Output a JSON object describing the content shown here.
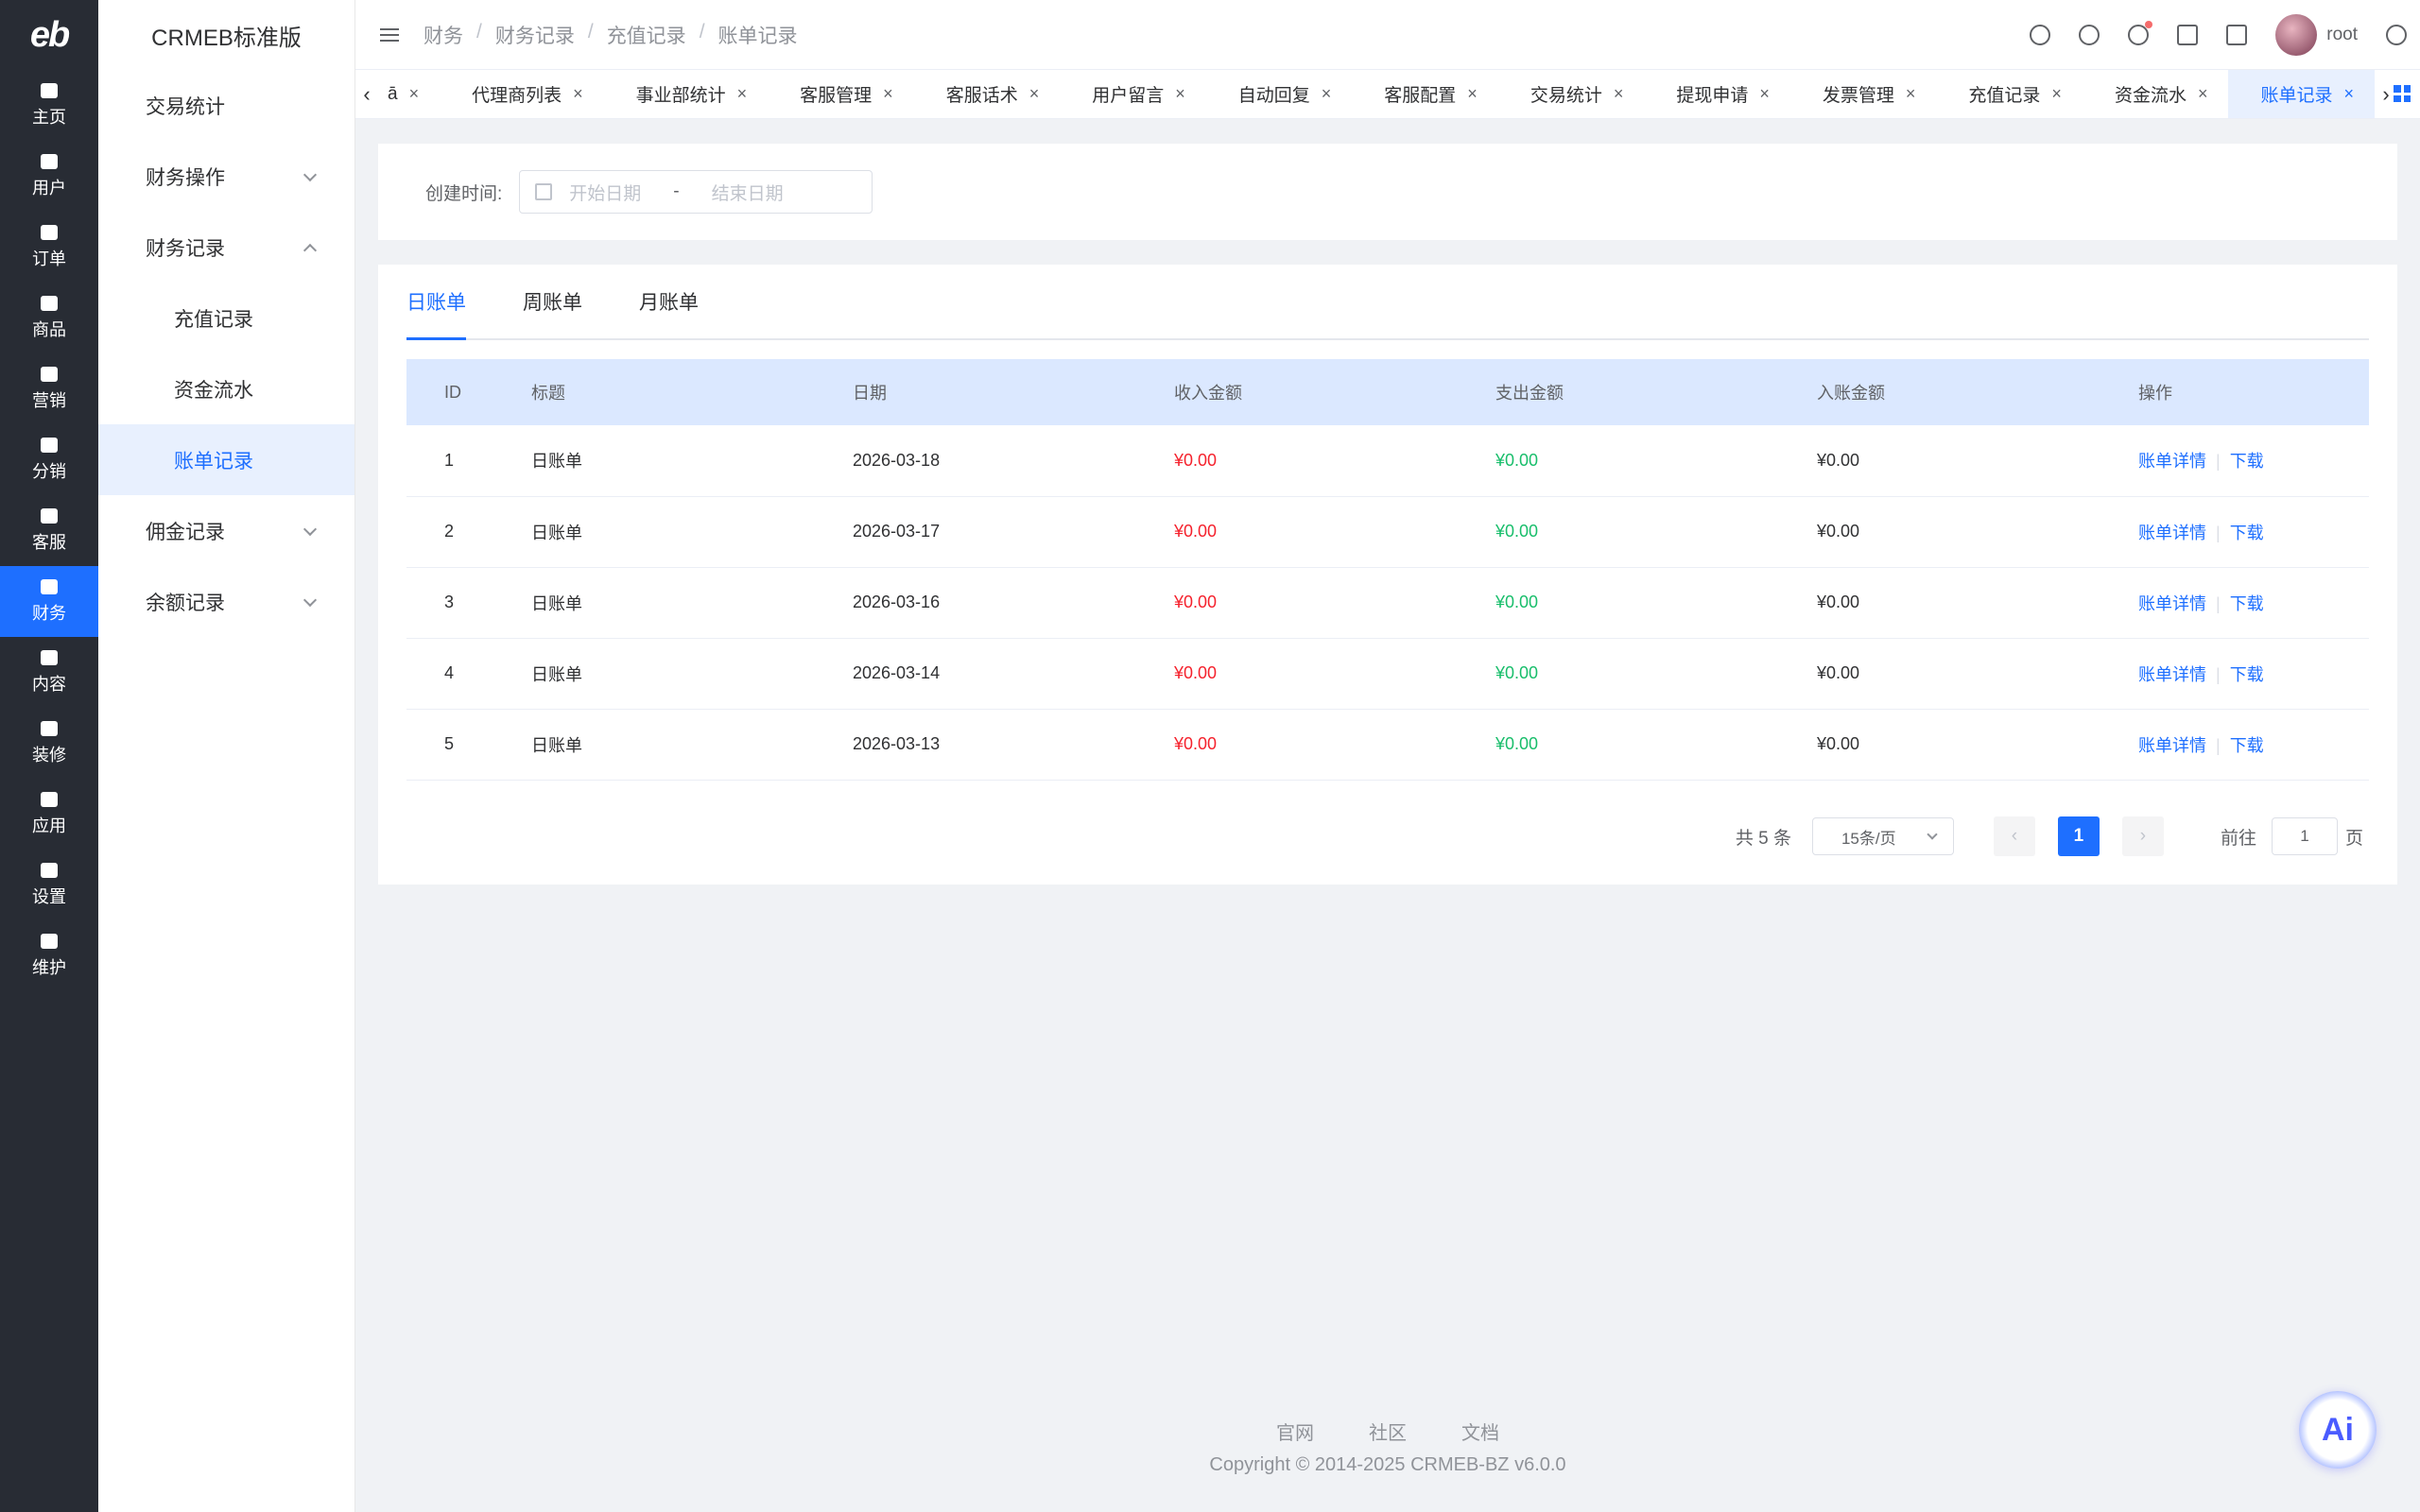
{
  "rail": {
    "logo": "eb",
    "items": [
      {
        "label": "主页",
        "icon": "home-icon"
      },
      {
        "label": "用户",
        "icon": "user-icon"
      },
      {
        "label": "订单",
        "icon": "order-icon"
      },
      {
        "label": "商品",
        "icon": "product-icon"
      },
      {
        "label": "营销",
        "icon": "marketing-icon"
      },
      {
        "label": "分销",
        "icon": "distribution-icon"
      },
      {
        "label": "客服",
        "icon": "service-icon"
      },
      {
        "label": "财务",
        "icon": "finance-icon"
      },
      {
        "label": "内容",
        "icon": "content-icon"
      },
      {
        "label": "装修",
        "icon": "decoration-icon"
      },
      {
        "label": "应用",
        "icon": "apps-icon"
      },
      {
        "label": "设置",
        "icon": "settings-icon"
      },
      {
        "label": "维护",
        "icon": "maintenance-icon"
      }
    ]
  },
  "submenu": {
    "brand": "CRMEB标准版",
    "items": [
      {
        "label": "交易统计"
      },
      {
        "label": "财务操作"
      },
      {
        "label": "财务记录"
      },
      {
        "label": "充值记录"
      },
      {
        "label": "资金流水"
      },
      {
        "label": "账单记录"
      },
      {
        "label": "佣金记录"
      },
      {
        "label": "余额记录"
      }
    ]
  },
  "header": {
    "breadcrumb": [
      "财务",
      "财务记录",
      "充值记录",
      "账单记录"
    ],
    "separator": "/",
    "user": "root"
  },
  "tabs": {
    "partial": "ā",
    "items": [
      "代理商列表",
      "事业部统计",
      "客服管理",
      "客服话术",
      "用户留言",
      "自动回复",
      "客服配置",
      "交易统计",
      "提现申请",
      "发票管理",
      "充值记录",
      "资金流水",
      "账单记录"
    ],
    "close": "×"
  },
  "filter": {
    "label": "创建时间:",
    "start_placeholder": "开始日期",
    "dash": "-",
    "end_placeholder": "结束日期"
  },
  "bill_tabs": [
    "日账单",
    "周账单",
    "月账单"
  ],
  "table": {
    "headers": [
      "ID",
      "标题",
      "日期",
      "收入金额",
      "支出金额",
      "入账金额",
      "操作"
    ],
    "rows": [
      {
        "id": "1",
        "title": "日账单",
        "date": "2026-03-18",
        "income": "¥0.00",
        "expense": "¥0.00",
        "net": "¥0.00"
      },
      {
        "id": "2",
        "title": "日账单",
        "date": "2026-03-17",
        "income": "¥0.00",
        "expense": "¥0.00",
        "net": "¥0.00"
      },
      {
        "id": "3",
        "title": "日账单",
        "date": "2026-03-16",
        "income": "¥0.00",
        "expense": "¥0.00",
        "net": "¥0.00"
      },
      {
        "id": "4",
        "title": "日账单",
        "date": "2026-03-14",
        "income": "¥0.00",
        "expense": "¥0.00",
        "net": "¥0.00"
      },
      {
        "id": "5",
        "title": "日账单",
        "date": "2026-03-13",
        "income": "¥0.00",
        "expense": "¥0.00",
        "net": "¥0.00"
      }
    ],
    "action_detail": "账单详情",
    "action_download": "下载"
  },
  "pagination": {
    "total": "共 5 条",
    "page_size": "15条/页",
    "prev": "‹",
    "current": "1",
    "next": "›",
    "goto_label": "前往",
    "goto_value": "1",
    "page_suffix": "页"
  },
  "footer": {
    "links": [
      "官网",
      "社区",
      "文档"
    ],
    "copyright": "Copyright © 2014-2025 CRMEB-BZ v6.0.0"
  },
  "ai_button": "Ai",
  "colors": {
    "accent": "#1e6fff",
    "income": "#f5222d",
    "expense": "#19be6b"
  }
}
